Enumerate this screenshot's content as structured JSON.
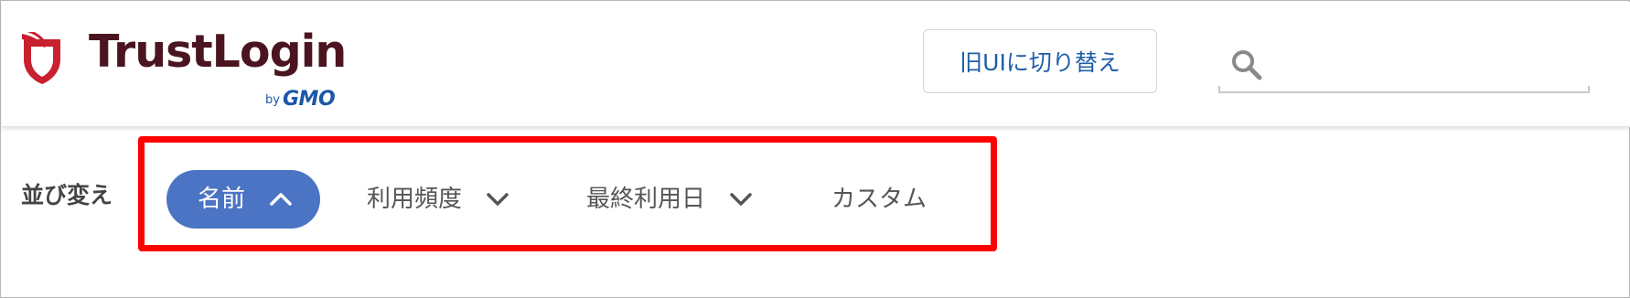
{
  "brand": {
    "name": "TrustLogin",
    "by": "by",
    "company": "GMO",
    "colors": {
      "wordmark": "#4a1520",
      "shield": "#c8202e",
      "gmo": "#1a57a8"
    }
  },
  "header": {
    "old_ui_button_label": "旧UIに切り替え",
    "search": {
      "placeholder": "",
      "value": "",
      "icon": "search-icon"
    }
  },
  "sort": {
    "label": "並び変え",
    "options": [
      {
        "label": "名前",
        "active": true,
        "direction": "up",
        "icon": "chevron-up-icon"
      },
      {
        "label": "利用頻度",
        "active": false,
        "direction": "down",
        "icon": "chevron-down-icon"
      },
      {
        "label": "最終利用日",
        "active": false,
        "direction": "down",
        "icon": "chevron-down-icon"
      },
      {
        "label": "カスタム",
        "active": false,
        "direction": null,
        "icon": null
      }
    ],
    "colors": {
      "active_bg": "#4b74c4",
      "active_text": "#ffffff",
      "inactive_text": "#555555",
      "highlight": "#ff0000"
    }
  }
}
